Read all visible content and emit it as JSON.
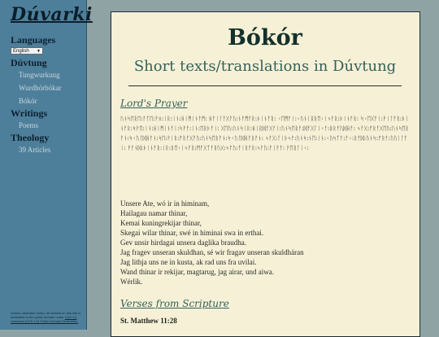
{
  "sidebar": {
    "logo": "Dúvarki",
    "languages_heading": "Languages",
    "language_select_value": "English",
    "duvtung_heading": "Dúvtung",
    "duvtung_items": [
      "Tungwurkung",
      "Wurdhórbókar",
      "Bókór"
    ],
    "writings_heading": "Writings",
    "writings_items": [
      "Poems"
    ],
    "theology_heading": "Theology",
    "theology_items": [
      "39 Articles"
    ],
    "footer_text": "Unless otherwise noted, all content on this site is dedicated to the public domain under",
    "footer_link": "CC0 1.0 Universal (CC0 1.0) Public Domain Dedication."
  },
  "main": {
    "title": "Bókór",
    "subtitle": "Short texts/translations in Dúvtung",
    "section1_heading": "Lord's Prayer",
    "runes": "ᚢᚾᛋᛖᚱᛖ:ᚨᛏᛖ:ᚹᛟ:ᛁᚱ:ᛁᚾ:ᚺᛁᛗᛁᚾᚨᛗ: ᚺᚨᛁᛚᚨᚷᚨᚢ:ᚾᚨᛗᚨᚱ:ᚦᛁᚾᚨᚱ: ᚲᛖᛗᚨᛁ:ᚲᚢᚾᛁᛝᚱᛖᚲᛁᛃᚨᚱ:ᚦᛁᚾᚨᚱ: ᛋᚲᛖᚷᚨᛁ:ᚹᛁᛚᚨᚱ:ᚦᛁᚾᚨᚱ:ᛋᚹᛖ:ᛁᚾ:ᚺᛁᛗᛁᚾᚨᛁ:ᛋᚹᚨ:ᛁᚾ:ᛖᚱᚦᚨᛁ: ᚷᛖᚢ:ᚢᚾᛋᛁᚱ:ᚺᛁᚱᛞᚨᚷᚨᛁ:ᚢᚾᛋᛖᚱᚨ:ᛞᚨᚷᛚᛁᚲᚨ:ᛒᚱᚨᚢᛞᚺᚨ: ᛃᚨᚷ:ᚠᚱᚨᚷᛖᚢ:ᚢᚾᛋᛖᚱᚨᚾ:ᛋᚲᚢᛚᛞᚺᚨᚾ:ᛋᛖ:ᚹᛁᚱ:ᚠᚱᚨᚷᚨᚢ:ᚢᚾᛋᛖᚱᚨᚾ:ᛋᚲᚢᛚᛞᚺᚨᚱᚨᚾ: ᛃᚨᚷ:ᛚᛁᚦᛃᚨ:ᚢᚾᛋ:ᚾᛖ:ᛁᚾ:ᚲᚢᛋᛏᚨ:ᚨᚲ:ᚱᚨᛞ:ᚢᚾᛋ:ᚠᚱᚨ:ᚢᚢᛁᛚᚨᛁ: ᚹᚨᚾᛞ:ᚦᛁᚾᚨᚱ:ᛁᚱ:ᚱᛖᚲᛁᛃᚨᚱ:ᛗᚨᚷᛏᚨᚱᚢᚷ:ᛃᚨᚢ:ᚨᛁᚱᚨᚱ:ᛃᚨᚢ:ᚨᛁᚹᚨ: ᚹᛖᚱᛚᛁᚲ:",
    "prayer_lines": [
      "Unsere Ate, wó ir in himinam,",
      "Hailagau namar thinar,",
      "Kemai kuningrekijar thinar,",
      "Skegai wilar thinar, swé in himinai swa in erthai.",
      "Gev unsir hirdagai unsera daglika braudha.",
      "Jag fragev unseran skuldhan, sé wir fragav unseran skuldháran",
      "Jag lithja uns ne in kusta, ak rad uns fra uvilai.",
      "Wand thinar ir rekijar, magtarug, jag airar, und aiwa.",
      "Wérlik."
    ],
    "section2_heading": "Verses from Scripture",
    "subsection_title": "St. Matthew 11:28"
  },
  "colors": {
    "sidebar_bg": "#4e7f9a",
    "page_bg": "#8fa3a4",
    "content_bg": "#f6f1d6",
    "heading_teal": "#34615c"
  }
}
